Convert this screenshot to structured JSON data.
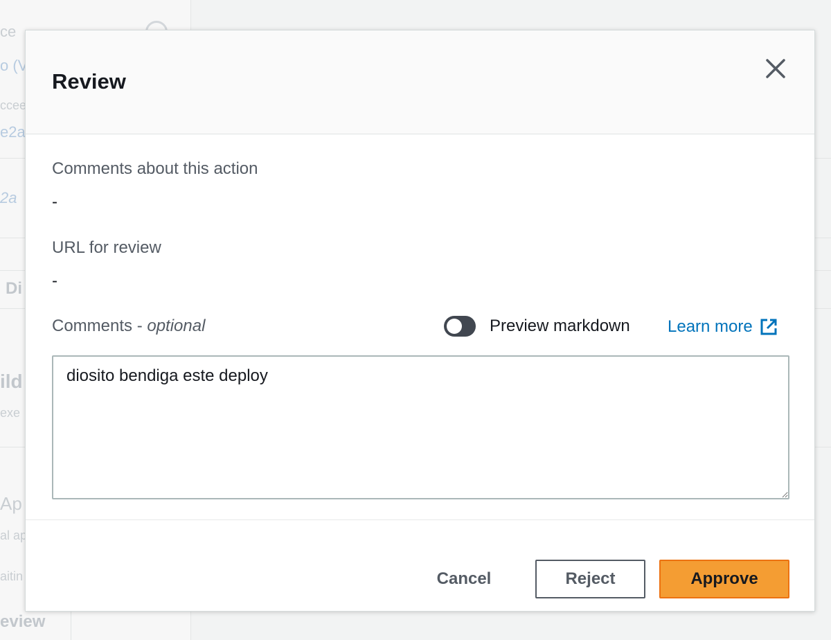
{
  "background": {
    "fragments": [
      "ce",
      "o (V",
      "ccee",
      "e2a",
      "2a",
      "Di",
      "ild",
      "exe",
      "Ap",
      "al ap",
      "aitin",
      "eview"
    ]
  },
  "modal": {
    "title": "Review",
    "close_icon": "close-icon",
    "comments_about_action": {
      "label": "Comments about this action",
      "value": "-"
    },
    "url_for_review": {
      "label": "URL for review",
      "value": "-"
    },
    "comments": {
      "label": "Comments - ",
      "label_optional": "optional",
      "value": "diosito bendiga este deploy"
    },
    "preview_markdown": {
      "label": "Preview markdown",
      "enabled": false
    },
    "learn_more": {
      "label": "Learn more",
      "icon": "external-link-icon"
    },
    "buttons": {
      "cancel": "Cancel",
      "reject": "Reject",
      "approve": "Approve"
    }
  },
  "colors": {
    "link": "#0073bb",
    "approve_bg": "#f49d33",
    "toggle_off": "#414750",
    "label_gray": "#545b64"
  }
}
